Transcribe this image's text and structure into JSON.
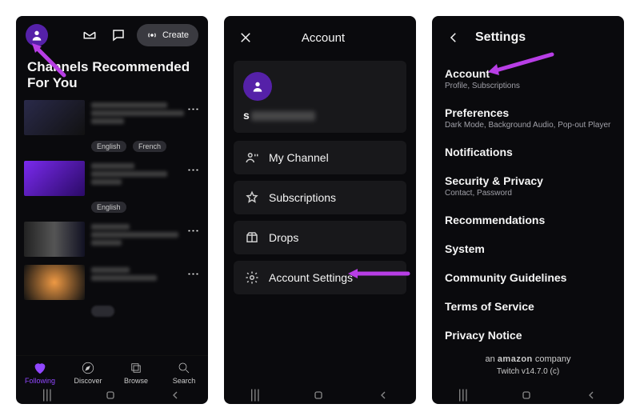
{
  "panel1": {
    "create_label": "Create",
    "section_title": "Channels Recommended For You",
    "tags": [
      "English",
      "French"
    ],
    "nav": [
      {
        "label": "Following",
        "active": true
      },
      {
        "label": "Discover",
        "active": false
      },
      {
        "label": "Browse",
        "active": false
      },
      {
        "label": "Search",
        "active": false
      }
    ]
  },
  "panel2": {
    "title": "Account",
    "username_prefix": "s",
    "menu": [
      {
        "icon": "channel",
        "label": "My Channel"
      },
      {
        "icon": "star",
        "label": "Subscriptions"
      },
      {
        "icon": "drops",
        "label": "Drops"
      },
      {
        "icon": "gear",
        "label": "Account Settings"
      }
    ]
  },
  "panel3": {
    "title": "Settings",
    "items": [
      {
        "label": "Account",
        "desc": "Profile, Subscriptions"
      },
      {
        "label": "Preferences",
        "desc": "Dark Mode, Background Audio, Pop-out Player"
      },
      {
        "label": "Notifications",
        "desc": ""
      },
      {
        "label": "Security & Privacy",
        "desc": "Contact, Password"
      },
      {
        "label": "Recommendations",
        "desc": ""
      },
      {
        "label": "System",
        "desc": ""
      },
      {
        "label": "Community Guidelines",
        "desc": ""
      },
      {
        "label": "Terms of Service",
        "desc": ""
      },
      {
        "label": "Privacy Notice",
        "desc": ""
      }
    ],
    "footer_company_pre": "an ",
    "footer_company_brand": "amazon",
    "footer_company_post": " company",
    "version": "Twitch v14.7.0 (c)"
  },
  "colors": {
    "purple": "#9147ff",
    "arrow": "#b83ee6"
  }
}
